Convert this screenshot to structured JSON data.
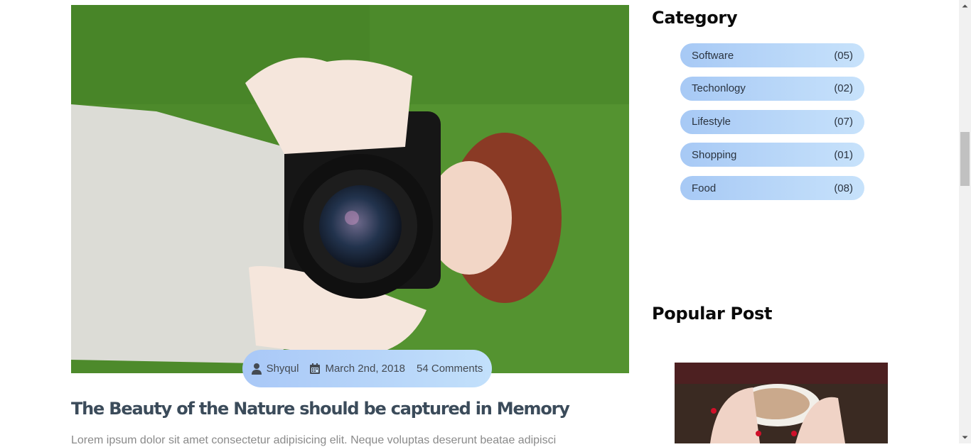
{
  "post": {
    "author": "Shyqul",
    "date": "March 2nd, 2018",
    "comments": "54 Comments",
    "title": "The Beauty of the Nature should be captured in Memory",
    "excerpt": "Lorem ipsum dolor sit amet consectetur adipisicing elit. Neque voluptas deserunt beatae adipisci"
  },
  "sidebar": {
    "category_title": "Category",
    "categories": [
      {
        "name": "Software",
        "count": "(05)"
      },
      {
        "name": "Techonlogy",
        "count": "(02)"
      },
      {
        "name": "Lifestyle",
        "count": "(07)"
      },
      {
        "name": "Shopping",
        "count": "(01)"
      },
      {
        "name": "Food",
        "count": "(08)"
      }
    ],
    "popular_title": "Popular Post"
  },
  "icons": {
    "author": "user-icon",
    "date": "calendar-icon"
  },
  "colors": {
    "pill_gradient_start": "#a9c8f7",
    "pill_gradient_end": "#c2e0fb",
    "title_color": "#3b4b5a"
  }
}
